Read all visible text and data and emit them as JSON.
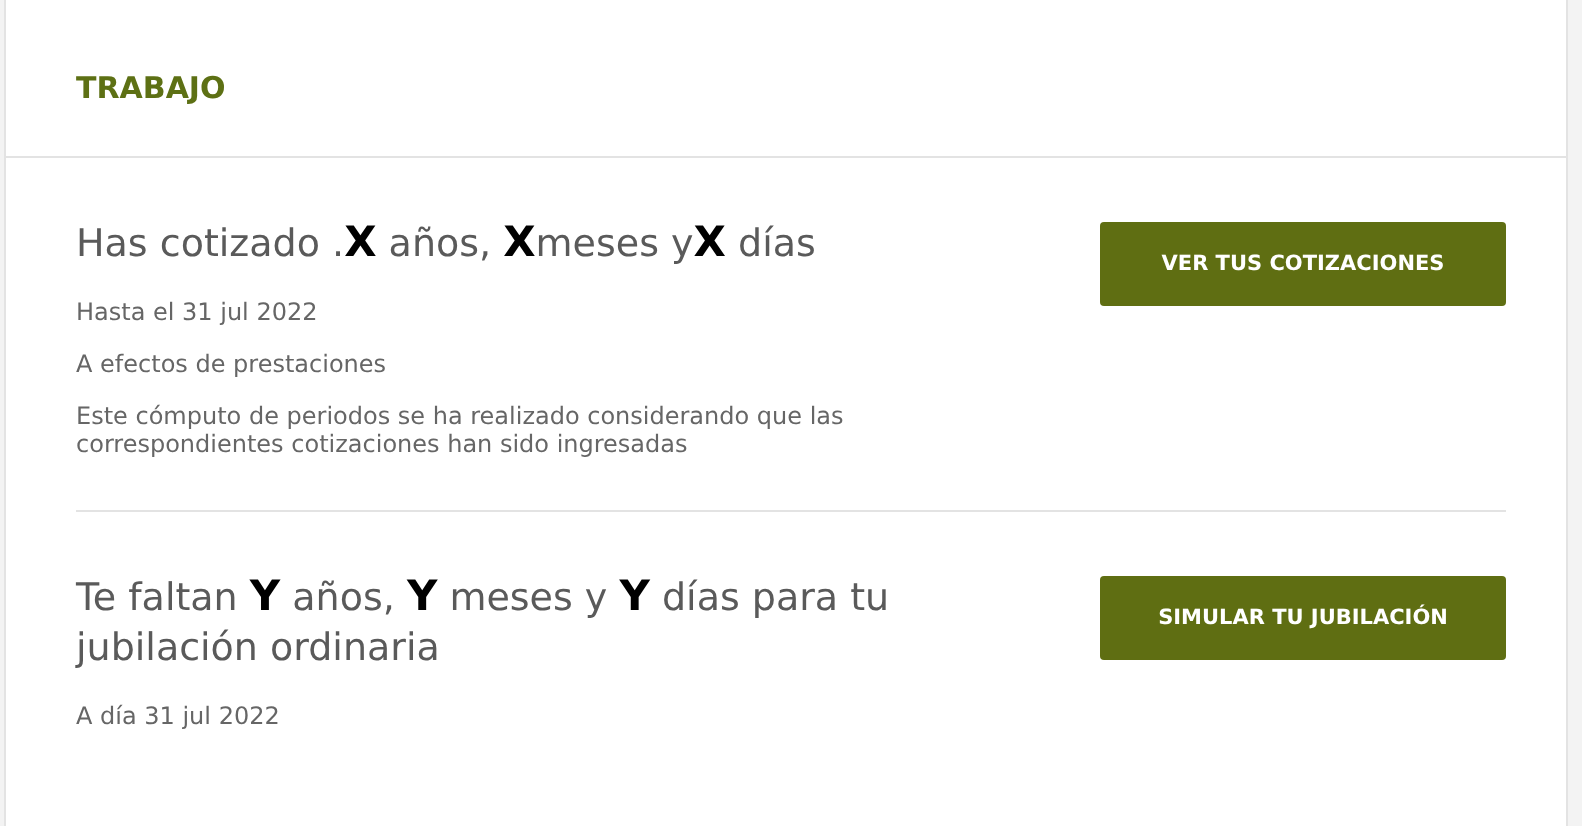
{
  "header": {
    "title": "TRABAJO"
  },
  "sections": [
    {
      "headline": "Has cotizado .**X** años, **X**meses y**X** días",
      "lines": [
        "Hasta el 31 jul 2022",
        "A efectos de prestaciones",
        "Este cómputo de periodos se ha realizado considerando que las correspondientes cotizaciones han sido ingresadas"
      ],
      "button": "VER TUS COTIZACIONES"
    },
    {
      "headline": "Te faltan **Y** años, **Y** meses y **Y** días para tu jubilación ordinaria",
      "lines": [
        "A día 31 jul 2022"
      ],
      "button": "SIMULAR TU JUBILACIÓN"
    }
  ]
}
